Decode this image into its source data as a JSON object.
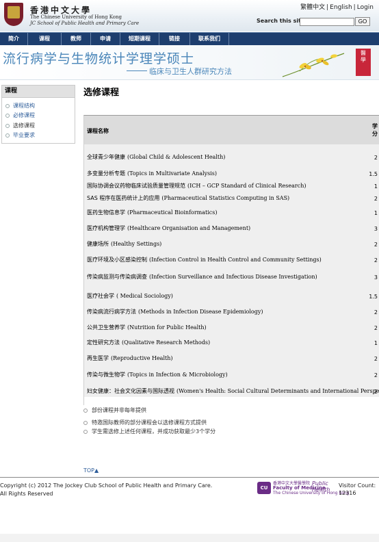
{
  "header": {
    "university_zh": "香港中文大學",
    "university_en": "The Chinese University of Hong Kong",
    "school_en": "JC School of Public Health and Primary Care",
    "lang_trad": "繁體中文",
    "lang_en": "English",
    "login": "Login",
    "search_label": "Search this site:",
    "search_value": "",
    "go_label": "GO"
  },
  "nav": [
    "简介",
    "课程",
    "教师",
    "申请",
    "短期课程",
    "链接",
    "联系我们"
  ],
  "banner": {
    "title": "流行病学与生物统计学理学硕士",
    "subtitle": "临床与卫生人群研究方法",
    "seal_text": "醫學"
  },
  "sidebar": {
    "title": "课程",
    "items": [
      "课程结构",
      "必修课程",
      "选修课程",
      "毕业要求"
    ]
  },
  "main": {
    "title": "选修课程",
    "header_name": "课程名称",
    "header_credit_1": "学",
    "header_credit_2": "分",
    "courses": [
      {
        "zh": "全球青少年健康",
        "en": "(Global Child & Adolescent Health)",
        "credit": "2"
      },
      {
        "zh": "多变量分析专题",
        "en": "(Topics in Multivariate Analysis)",
        "credit": "1.5"
      },
      {
        "zh": "国际协调会议药物临床试验质量管理规范",
        "en": "(ICH – GCP Standard of Clinical Research)",
        "credit": "1"
      },
      {
        "zh": "SAS 程序在医药统计上的应用",
        "en": "(Pharmaceutical Statistics Computing in SAS)",
        "credit": "2"
      },
      {
        "zh": "医药生物信息学",
        "en": "(Pharmaceutical Bioinformatics)",
        "credit": "1"
      },
      {
        "zh": "医疗机构管理学",
        "en": "(Healthcare Organisation and Management)",
        "credit": "3"
      },
      {
        "zh": "健康场所",
        "en": "(Healthy Settings)",
        "credit": "2"
      },
      {
        "zh": "医疗环境及小区感染控制",
        "en": "(Infection Control in Health Control and Community Settings)",
        "credit": "2"
      },
      {
        "zh": "传染病监测与传染病调查",
        "en": "(Infection Surveillance and Infectious Disease Investigation)",
        "credit": "3"
      },
      {
        "zh": "医疗社会学",
        "en": "( Medical Sociology)",
        "credit": "1.5"
      },
      {
        "zh": "传染病流行病学方法",
        "en": "(Methods in Infection Disease Epidemiology)",
        "credit": "2"
      },
      {
        "zh": "公共卫生营养学",
        "en": "(Nutrition for Public Health)",
        "credit": "2"
      },
      {
        "zh": "定性研究方法",
        "en": "(Qualitative Research Methods)",
        "credit": "1"
      },
      {
        "zh": "再生医学",
        "en": "(Reproductive Health)",
        "credit": "2"
      },
      {
        "zh": "传染与微生物学",
        "en": "(Topics in Infection & Microbiology)",
        "credit": "2"
      },
      {
        "zh": "妇女健康：社会文化因素与国际透视",
        "en": "(Women's Health: Social Cultural Determinants and International Perspectives)",
        "credit": "2"
      }
    ],
    "notes": [
      "部份课程并非每年提供",
      "特邀国际教师的部分课程会以选修课程方式提供",
      "学生需选修上述任何课程，并成功获取最少3个学分"
    ],
    "top_link": "TOP▲"
  },
  "footer": {
    "copyright_1": "Copyright (c) 2012 The Jockey Club School of Public Health and Primary Care.",
    "copyright_2": "All Rights Reserved",
    "cu_logo": "CU",
    "fom_zh": "香港中文大學醫學院",
    "fom_en": "Faculty of Medicine",
    "fom_sub": "The Chinese University of Hong Kong",
    "ph_logo": "Public Health",
    "visitor_label": "Visitor Count:",
    "visitor_count": "12316"
  },
  "colors": {
    "nav_bg": "#1d3e6e",
    "banner_text": "#4a86b9",
    "link": "#2f5e9a",
    "row_bg": "#efefef",
    "header_row_bg": "#dcdcdc"
  }
}
